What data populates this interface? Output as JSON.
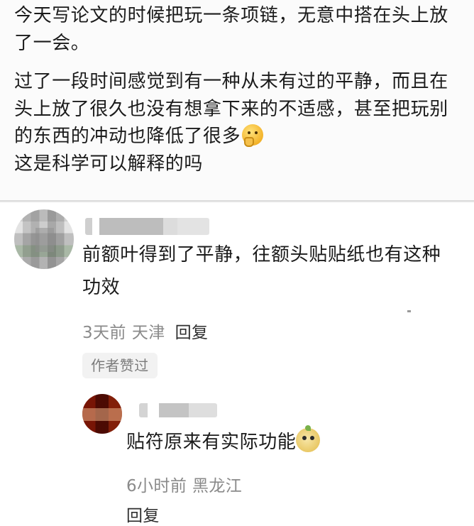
{
  "post": {
    "paragraphs": [
      "今天写论文的时候把玩一条项链，无意中搭在头上放了一会。",
      "过了一段时间感觉到有一种从未有过的平静，而且在头上放了很久也没有想拿下来的不适感，甚至把玩别的东西的冲动也降低了很多",
      "这是科学可以解释的吗"
    ],
    "emoji": "thinking-face-icon"
  },
  "comment": {
    "avatar": "blurred-avatar",
    "username_blurred": true,
    "text": "前额叶得到了平静，往额头贴贴纸也有这种功效",
    "time": "3天前",
    "location": "天津",
    "reply_label": "回复",
    "badge": "作者赞过"
  },
  "reply": {
    "avatar": "blurred-avatar",
    "username_blurred": true,
    "text": "贴符原来有实际功能",
    "emoji": "sprout-face-icon",
    "time": "6小时前",
    "location": "黑龙江",
    "reply_label": "回复"
  },
  "colors": {
    "text": "#1b1b1b",
    "meta": "#8a8a8a",
    "badge_bg": "#f2f2f2",
    "post_bg": "#fbfbfb"
  }
}
